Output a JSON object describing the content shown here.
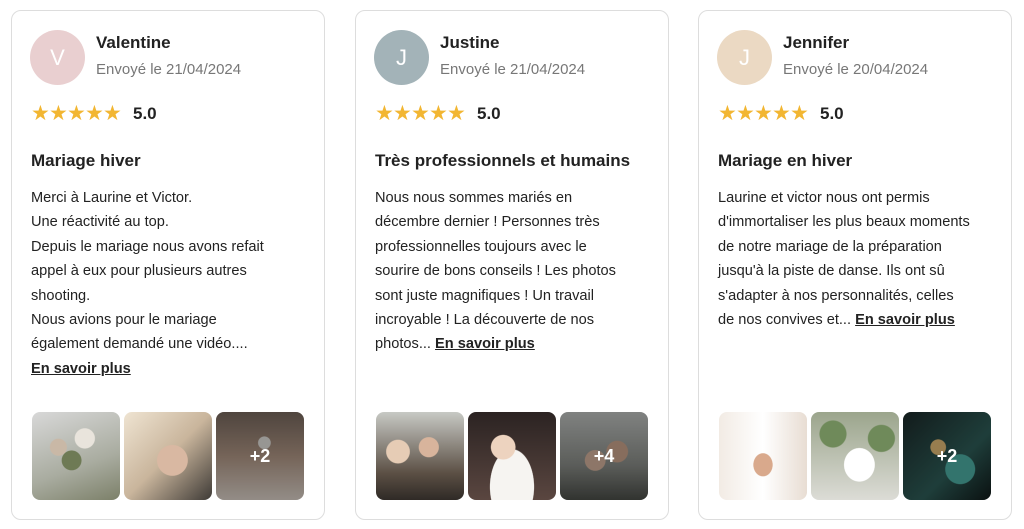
{
  "reviews": [
    {
      "initial": "V",
      "avatar_color": "#e9cfd0",
      "name": "Valentine",
      "date": "Envoyé le 21/04/2024",
      "rating": 5,
      "score": "5.0",
      "title": "Mariage hiver",
      "body_lines": [
        "Merci à Laurine et Victor.",
        "Une réactivité au top.",
        "Depuis le mariage nous avons refait",
        "appel à eux pour plusieurs autres",
        "shooting.",
        "Nous avions pour le mariage",
        "également demandé une vidéo...."
      ],
      "more_label": "En savoir plus",
      "photos": [
        "bouquet",
        "hands",
        "hair"
      ],
      "extra_count": "+2"
    },
    {
      "initial": "J",
      "avatar_color": "#a3b3b8",
      "name": "Justine",
      "date": "Envoyé le 21/04/2024",
      "rating": 5,
      "score": "5.0",
      "title": "Très professionnels et humains",
      "body_lines": [
        "Nous nous sommes mariés en",
        "décembre dernier ! Personnes très",
        "professionnelles toujours avec le",
        "sourire de bons conseils ! Les photos",
        "sont juste magnifiques ! Un travail",
        "incroyable ! La découverte de nos",
        "photos..."
      ],
      "more_label": "En savoir plus",
      "photos": [
        "guests",
        "bride",
        "couple"
      ],
      "extra_count": "+4"
    },
    {
      "initial": "J",
      "avatar_color": "#ebd9c3",
      "name": "Jennifer",
      "date": "Envoyé le 20/04/2024",
      "rating": 5,
      "score": "5.0",
      "title": "Mariage en hiver",
      "body_lines": [
        "Laurine et victor nous ont permis",
        "d'immortaliser les plus beaux moments",
        "de notre mariage de la préparation",
        "jusqu'à la piste de danse. Ils ont sû",
        "s'adapter à nos personnalités, celles",
        "de nos convives et..."
      ],
      "more_label": "En savoir plus",
      "photos": [
        "dress",
        "ring-box",
        "dance"
      ],
      "extra_count": "+2"
    }
  ]
}
